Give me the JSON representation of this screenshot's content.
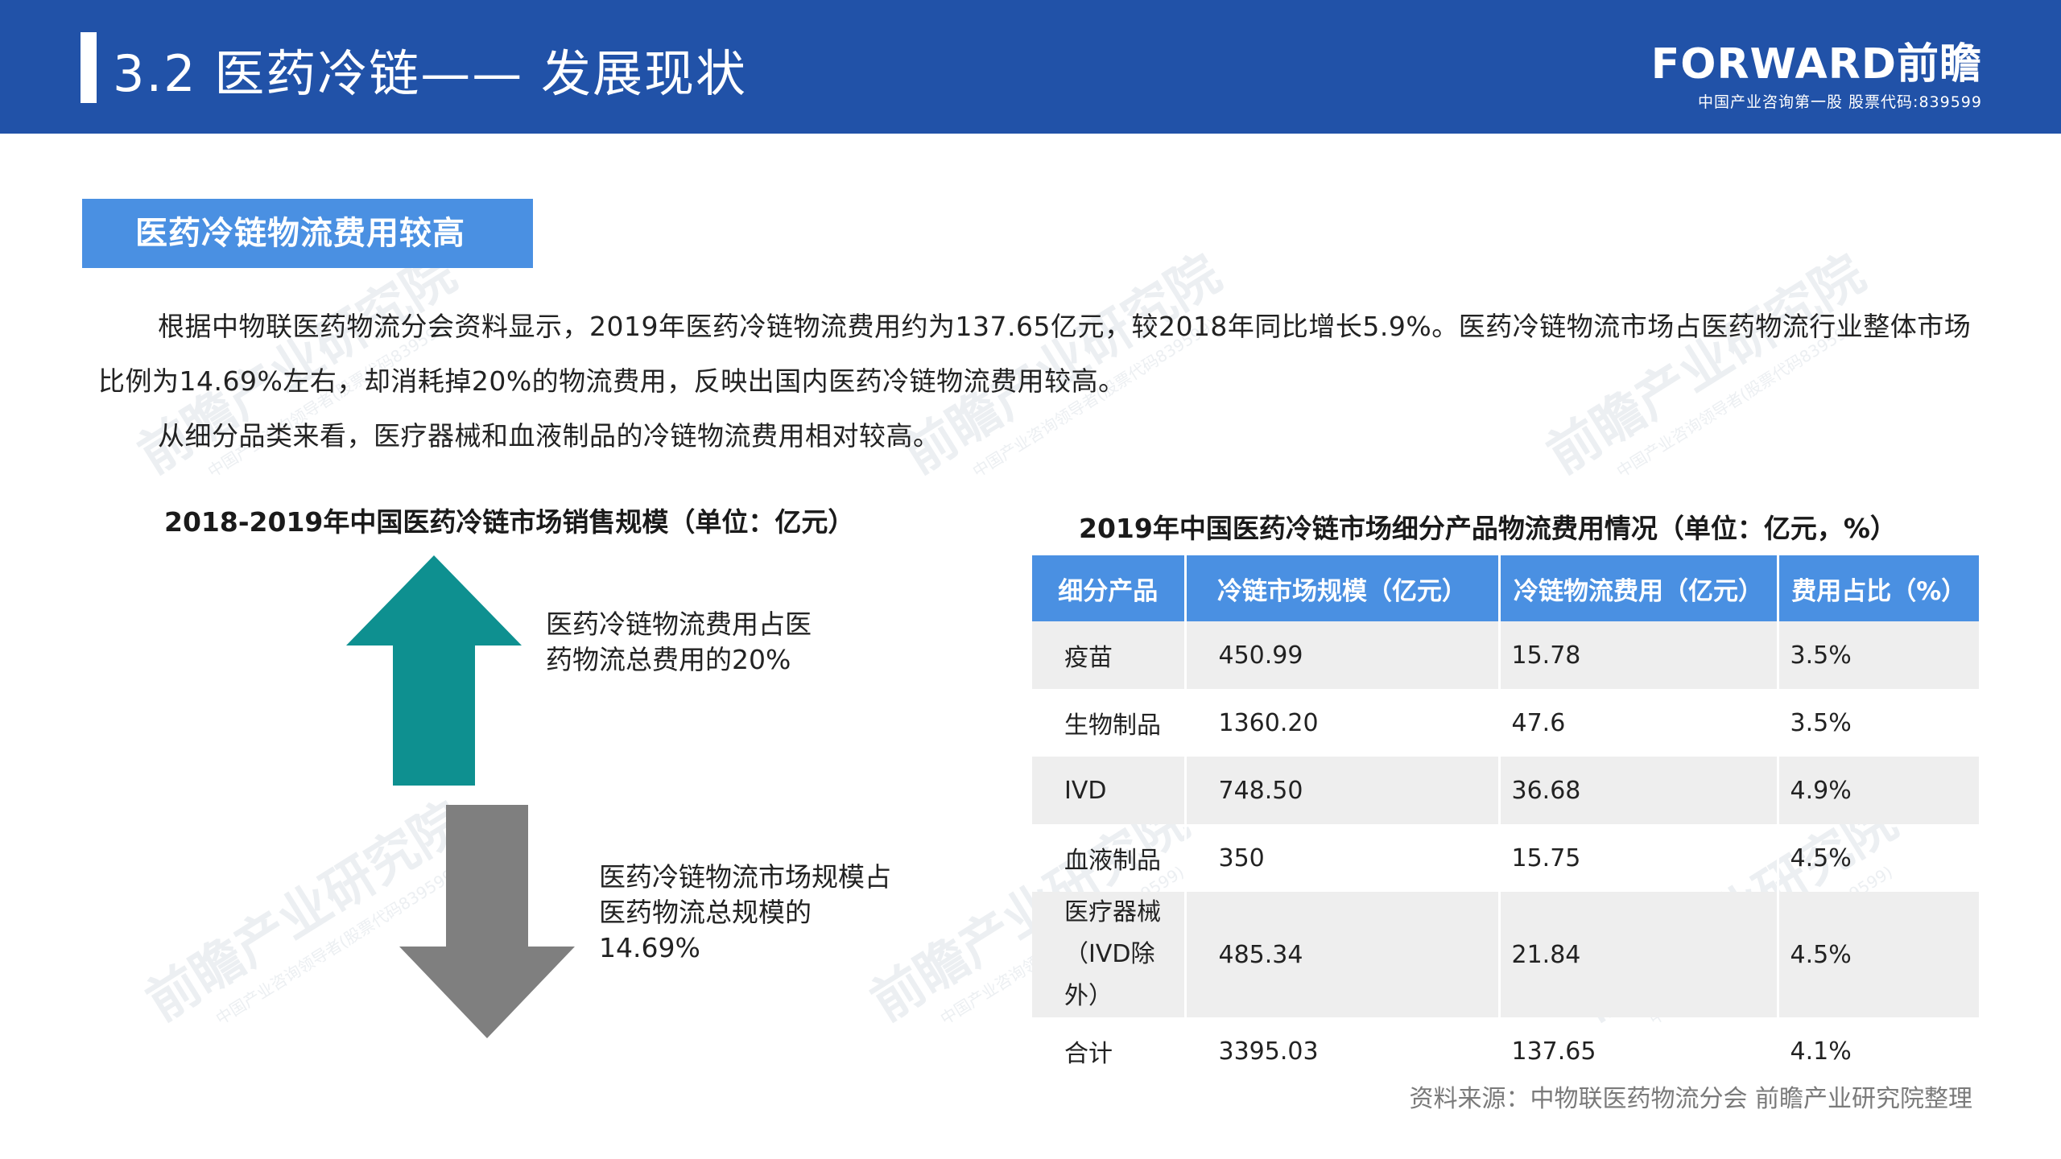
{
  "header": {
    "title": "3.2 医药冷链—— 发展现状",
    "logo_main": "FORWARD前瞻",
    "logo_sub": "中国产业咨询第一股  股票代码:839599"
  },
  "watermark": {
    "text": "前瞻产业研究院",
    "sub": "中国产业咨询领导者(股票代码839599)"
  },
  "section": {
    "label": "医药冷链物流费用较高"
  },
  "paragraphs": {
    "p1": "根据中物联医药物流分会资料显示，2019年医药冷链物流费用约为137.65亿元，较2018年同比增长5.9%。医药冷链物流市场占医药物流行业整体市场比例为14.69%左右，却消耗掉20%的物流费用，反映出国内医药冷链物流费用较高。",
    "p2": "从细分品类来看，医疗器械和血液制品的冷链物流费用相对较高。"
  },
  "left_chart": {
    "title": "2018-2019年中国医药冷链市场销售规模（单位：亿元）",
    "up_text": "医药冷链物流费用占医药物流总费用的20%",
    "down_text": "医药冷链物流市场规模占医药物流总规模的14.69%",
    "up_color": "#0e9090",
    "down_color": "#7f7f7f"
  },
  "table": {
    "title": "2019年中国医药冷链市场细分产品物流费用情况（单位：亿元，%）",
    "headers": [
      "细分产品",
      "冷链市场规模（亿元）",
      "冷链物流费用（亿元）",
      "费用占比（%）"
    ],
    "rows": [
      [
        "疫苗",
        "450.99",
        "15.78",
        "3.5%"
      ],
      [
        "生物制品",
        "1360.20",
        "47.6",
        "3.5%"
      ],
      [
        "IVD",
        "748.50",
        "36.68",
        "4.9%"
      ],
      [
        "血液制品",
        "350",
        "15.75",
        "4.5%"
      ],
      [
        "医疗器械（IVD除外）",
        "485.34",
        "21.84",
        "4.5%"
      ],
      [
        "合计",
        "3395.03",
        "137.65",
        "4.1%"
      ]
    ],
    "header_color": "#4a90e2"
  },
  "source": "资料来源：中物联医药物流分会 前瞻产业研究院整理"
}
